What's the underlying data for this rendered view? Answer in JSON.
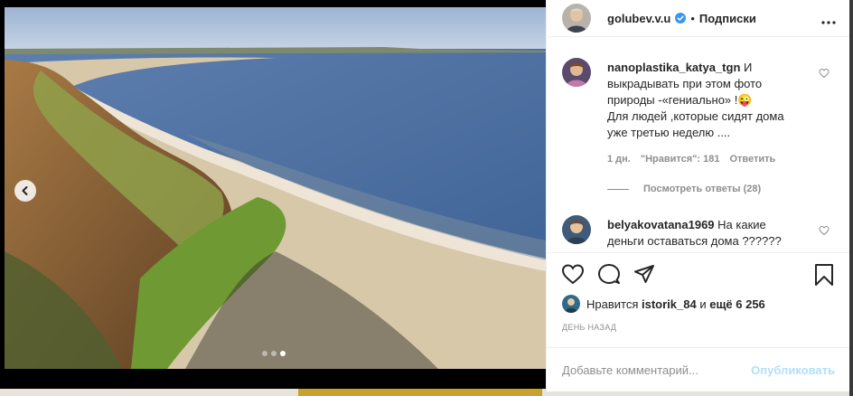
{
  "post": {
    "author": "golubev.v.u",
    "separator": "•",
    "follow_label": "Подписки",
    "more_icon": "more-options-icon"
  },
  "carousel": {
    "total": 3,
    "active": 3
  },
  "comments": [
    {
      "user": "nanoplastika_katya_tgn",
      "text_lines": [
        "И",
        "выкрадывать при этом фото",
        "природы -«гениально» !😜",
        "Для людей ,которые сидят дома",
        "уже третью неделю ...."
      ],
      "age": "1 дн.",
      "likes": "\"Нравится\": 181",
      "reply_label": "Ответить",
      "view_replies": "Посмотреть ответы (28)"
    },
    {
      "user": "belyakovatana1969",
      "text_lines": [
        "На какие",
        "деньги оставаться дома ??????"
      ]
    }
  ],
  "likes": {
    "prefix": "Нравится",
    "user": "istorik_84",
    "and": "и",
    "others": "ещё 6 256"
  },
  "time_label": "ДЕНЬ НАЗАД",
  "add_comment": {
    "placeholder": "Добавьте комментарий...",
    "publish_label": "Опубликовать"
  },
  "colors": {
    "verified": "#3897f0",
    "publish_disabled": "#b2dffc",
    "muted": "#8e8e8e"
  }
}
